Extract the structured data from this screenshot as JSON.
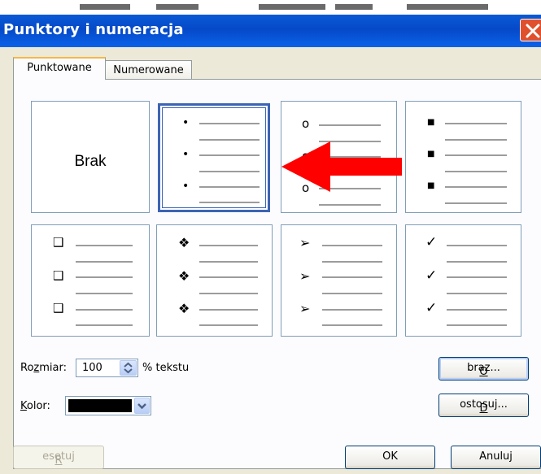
{
  "dialog": {
    "title": "Punktory i numeracja"
  },
  "tabs": [
    {
      "label": "Punktowane",
      "active": true
    },
    {
      "label": "Numerowane",
      "active": false
    }
  ],
  "gallery": {
    "none_label": "Brak",
    "selected_index": 1,
    "styles": [
      {
        "name": "none"
      },
      {
        "name": "small-dot-bullet",
        "glyph": "•"
      },
      {
        "name": "hollow-circle-bullet",
        "glyph": "o"
      },
      {
        "name": "square-bullet",
        "glyph": "■"
      },
      {
        "name": "hollow-square-bullet",
        "glyph": "❑"
      },
      {
        "name": "four-diamond-bullet",
        "glyph": "❖"
      },
      {
        "name": "arrowhead-bullet",
        "glyph": "➢"
      },
      {
        "name": "checkmark-bullet",
        "glyph": "✓"
      }
    ]
  },
  "annotation": {
    "arrow_color": "#ff0000",
    "points_to": "small-dot-bullet"
  },
  "size": {
    "label": "Rozmiar:",
    "value": "100",
    "unit": "% tekstu"
  },
  "color": {
    "label": "Kolor:",
    "value": "#000000"
  },
  "buttons": {
    "picture": "Obraz...",
    "customize": "Dostosuj...",
    "reset": "Resetuj",
    "ok": "OK",
    "cancel": "Anuluj"
  }
}
